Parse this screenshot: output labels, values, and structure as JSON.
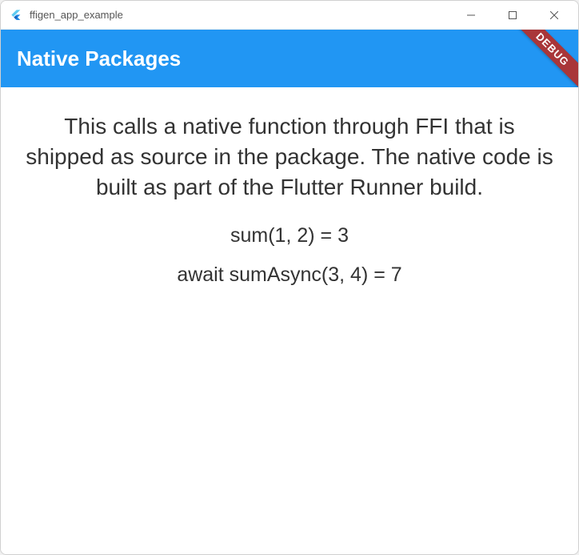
{
  "window": {
    "title": "ffigen_app_example"
  },
  "appbar": {
    "title": "Native Packages",
    "debug_label": "DEBUG"
  },
  "content": {
    "description": "This calls a native function through FFI that is shipped as source in the package. The native code is built as part of the Flutter Runner build.",
    "sum_result": "sum(1, 2) = 3",
    "sum_async_result": "await sumAsync(3, 4) = 7"
  }
}
